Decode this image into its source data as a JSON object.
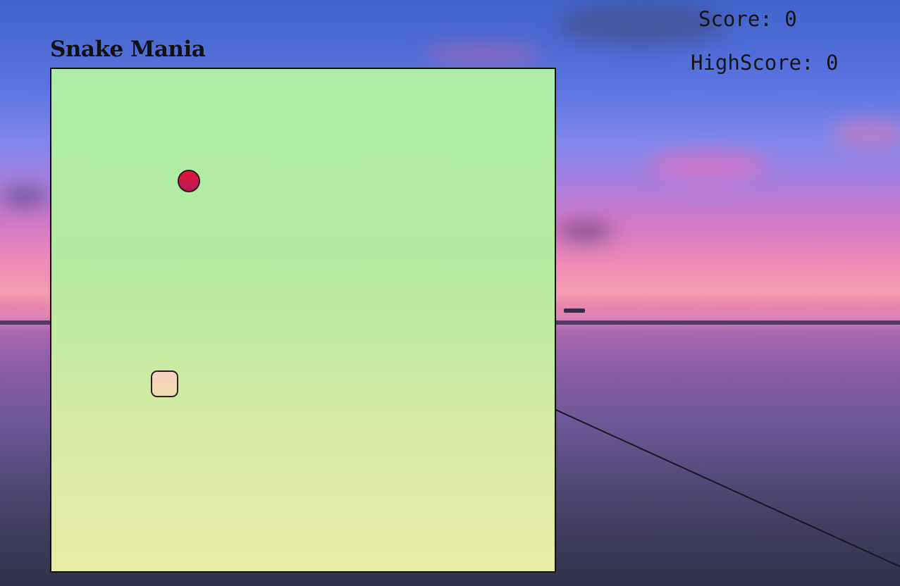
{
  "game": {
    "title": "Snake Mania",
    "score_label": "Score: 0",
    "highscore_label": "HighScore: 0"
  },
  "board": {
    "food_color": "#e31337",
    "snake_head_color": "#f9cfc7"
  },
  "colors": {
    "board_top": "#aeeda9",
    "board_bottom": "#e9eca7",
    "text": "#151515"
  }
}
